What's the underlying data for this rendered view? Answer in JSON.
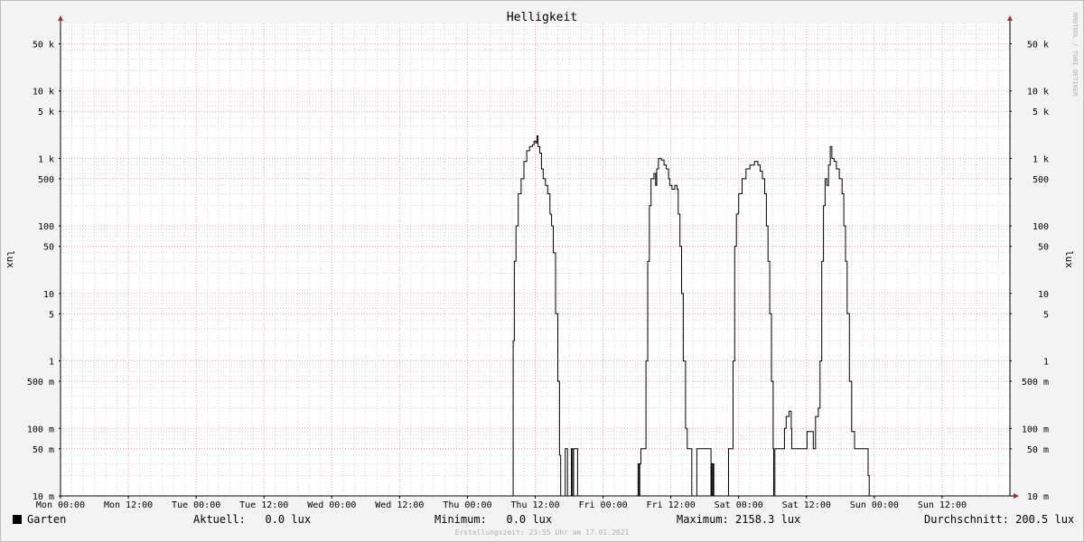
{
  "chart_data": {
    "type": "line",
    "title": "Helligkeit",
    "ylabel": "lux",
    "y_scale": "log",
    "ylim": [
      0.01,
      100000
    ],
    "y_ticks": [
      {
        "value": 50000,
        "label": "50 k"
      },
      {
        "value": 10000,
        "label": "10 k"
      },
      {
        "value": 5000,
        "label": "5 k"
      },
      {
        "value": 1000,
        "label": "1 k"
      },
      {
        "value": 500,
        "label": "500"
      },
      {
        "value": 100,
        "label": "100"
      },
      {
        "value": 50,
        "label": "50"
      },
      {
        "value": 10,
        "label": "10"
      },
      {
        "value": 5,
        "label": "5"
      },
      {
        "value": 1,
        "label": "1"
      },
      {
        "value": 0.5,
        "label": "500 m"
      },
      {
        "value": 0.1,
        "label": "100 m"
      },
      {
        "value": 0.05,
        "label": "50 m"
      },
      {
        "value": 0.01,
        "label": "10 m"
      }
    ],
    "x_unit": "hours",
    "xlim": [
      0,
      168
    ],
    "x_ticks": [
      {
        "value": 0,
        "label": "Mon 00:00"
      },
      {
        "value": 12,
        "label": "Mon 12:00"
      },
      {
        "value": 24,
        "label": "Tue 00:00"
      },
      {
        "value": 36,
        "label": "Tue 12:00"
      },
      {
        "value": 48,
        "label": "Wed 00:00"
      },
      {
        "value": 60,
        "label": "Wed 12:00"
      },
      {
        "value": 72,
        "label": "Thu 00:00"
      },
      {
        "value": 84,
        "label": "Thu 12:00"
      },
      {
        "value": 96,
        "label": "Fri 00:00"
      },
      {
        "value": 108,
        "label": "Fri 12:00"
      },
      {
        "value": 120,
        "label": "Sat 00:00"
      },
      {
        "value": 132,
        "label": "Sat 12:00"
      },
      {
        "value": 144,
        "label": "Sun 00:00"
      },
      {
        "value": 156,
        "label": "Sun 12:00"
      }
    ],
    "grid": true,
    "series": [
      {
        "name": "Garten",
        "color": "#000000",
        "points": [
          [
            0,
            0.01
          ],
          [
            79.9,
            0.01
          ],
          [
            80.1,
            2
          ],
          [
            80.3,
            30
          ],
          [
            80.6,
            100
          ],
          [
            81,
            300
          ],
          [
            81.5,
            500
          ],
          [
            82,
            900
          ],
          [
            82.5,
            1300
          ],
          [
            83,
            1500
          ],
          [
            83.5,
            1600
          ],
          [
            83.8,
            1800
          ],
          [
            84.1,
            1700
          ],
          [
            84.3,
            2158
          ],
          [
            84.5,
            1500
          ],
          [
            84.8,
            1200
          ],
          [
            85.1,
            700
          ],
          [
            85.4,
            500
          ],
          [
            85.8,
            400
          ],
          [
            86.2,
            300
          ],
          [
            86.6,
            150
          ],
          [
            86.9,
            100
          ],
          [
            87.2,
            40
          ],
          [
            87.6,
            5
          ],
          [
            88,
            0.5
          ],
          [
            88.3,
            0.04
          ],
          [
            88.5,
            0.01
          ],
          [
            89,
            0.01
          ],
          [
            89.3,
            0.05
          ],
          [
            89.5,
            0.05
          ],
          [
            89.7,
            0.01
          ],
          [
            90.2,
            0.01
          ],
          [
            90.4,
            0.05
          ],
          [
            90.6,
            0.01
          ],
          [
            90.8,
            0.05
          ],
          [
            91.4,
            0.05
          ],
          [
            91.5,
            0.01
          ],
          [
            102,
            0.01
          ],
          [
            102.2,
            0.03
          ],
          [
            102.4,
            0.01
          ],
          [
            102.5,
            0.03
          ],
          [
            102.7,
            0.05
          ],
          [
            103.4,
            0.05
          ],
          [
            103.6,
            1
          ],
          [
            103.9,
            30
          ],
          [
            104.2,
            200
          ],
          [
            104.5,
            500
          ],
          [
            105,
            600
          ],
          [
            105.3,
            400
          ],
          [
            105.5,
            700
          ],
          [
            105.8,
            1000
          ],
          [
            106.3,
            950
          ],
          [
            106.8,
            800
          ],
          [
            107.2,
            700
          ],
          [
            107.6,
            500
          ],
          [
            107.8,
            400
          ],
          [
            108.2,
            350
          ],
          [
            108.7,
            400
          ],
          [
            109.1,
            350
          ],
          [
            109.3,
            150
          ],
          [
            109.6,
            50
          ],
          [
            109.9,
            10
          ],
          [
            110.2,
            1
          ],
          [
            110.6,
            0.1
          ],
          [
            110.9,
            0.05
          ],
          [
            111.6,
            0.05
          ],
          [
            111.7,
            0.01
          ],
          [
            112.5,
            0.01
          ],
          [
            112.6,
            0.05
          ],
          [
            115,
            0.05
          ],
          [
            115.1,
            0.01
          ],
          [
            115.2,
            0.03
          ],
          [
            115.4,
            0.01
          ],
          [
            115.5,
            0.03
          ],
          [
            115.6,
            0.01
          ],
          [
            118,
            0.01
          ],
          [
            118.2,
            0.05
          ],
          [
            118.8,
            0.05
          ],
          [
            119,
            1
          ],
          [
            119.3,
            50
          ],
          [
            119.6,
            150
          ],
          [
            120,
            300
          ],
          [
            120.6,
            500
          ],
          [
            121.3,
            700
          ],
          [
            122,
            800
          ],
          [
            122.8,
            900
          ],
          [
            123.4,
            800
          ],
          [
            123.8,
            650
          ],
          [
            124.2,
            500
          ],
          [
            124.6,
            300
          ],
          [
            124.9,
            100
          ],
          [
            125.2,
            30
          ],
          [
            125.5,
            5
          ],
          [
            125.8,
            0.5
          ],
          [
            126.1,
            0.05
          ],
          [
            126.2,
            0.01
          ],
          [
            126.4,
            0.05
          ],
          [
            127.9,
            0.05
          ],
          [
            128.1,
            0.1
          ],
          [
            128.4,
            0.15
          ],
          [
            128.9,
            0.18
          ],
          [
            129.1,
            0.18
          ],
          [
            129.3,
            0.1
          ],
          [
            129.4,
            0.05
          ],
          [
            131.9,
            0.05
          ],
          [
            132.1,
            0.09
          ],
          [
            133.1,
            0.09
          ],
          [
            133.2,
            0.05
          ],
          [
            133.4,
            0.05
          ],
          [
            133.6,
            0.15
          ],
          [
            133.9,
            0.15
          ],
          [
            134.1,
            0.2
          ],
          [
            134.4,
            1
          ],
          [
            134.7,
            30
          ],
          [
            135,
            200
          ],
          [
            135.3,
            500
          ],
          [
            135.6,
            400
          ],
          [
            135.9,
            800
          ],
          [
            136.2,
            1500
          ],
          [
            136.5,
            1000
          ],
          [
            136.9,
            900
          ],
          [
            137.3,
            700
          ],
          [
            137.8,
            500
          ],
          [
            138.3,
            300
          ],
          [
            138.6,
            100
          ],
          [
            138.9,
            30
          ],
          [
            139.2,
            5
          ],
          [
            139.6,
            0.5
          ],
          [
            140,
            0.09
          ],
          [
            140.3,
            0.09
          ],
          [
            140.5,
            0.05
          ],
          [
            142.5,
            0.05
          ],
          [
            142.9,
            0.02
          ],
          [
            143.1,
            0.01
          ],
          [
            168,
            0.01
          ]
        ]
      }
    ]
  },
  "legend": {
    "series_name": "Garten",
    "aktuell": "Aktuell:   0.0 lux",
    "minimum": "Minimum:   0.0 lux",
    "maximum": "Maximum: 2158.3 lux",
    "durchschnitt": "Durchschnitt: 200.5 lux"
  },
  "watermark": "RRDTOOL / TOBI OETIKER",
  "footer": "Erstellungszeit: 23:55 Uhr am 17.01.2021",
  "colors": {
    "grid_major": "#e8a0a8",
    "grid_minor": "#d4d4d4",
    "axis": "#000000",
    "arrow": "#a03030",
    "line": "#000000"
  }
}
